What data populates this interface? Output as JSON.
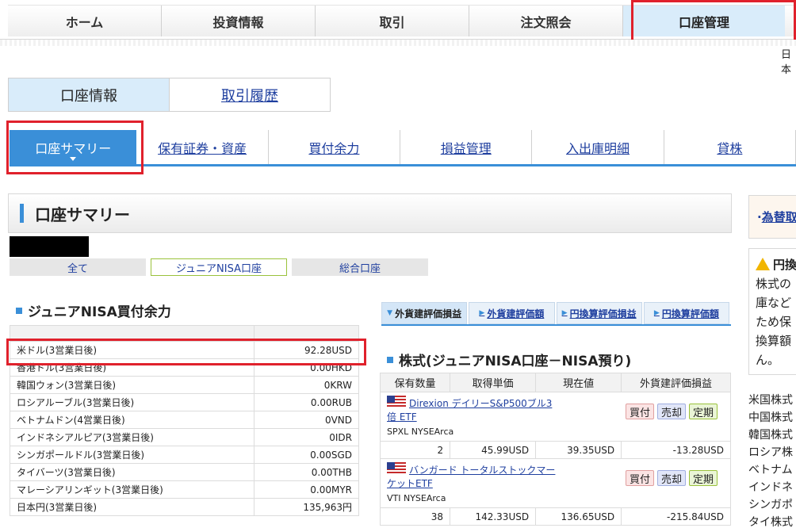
{
  "topnav": [
    "ホーム",
    "投資情報",
    "取引",
    "注文照会",
    "口座管理"
  ],
  "lang": "日本",
  "subtabs": [
    "口座情報",
    "取引履歴"
  ],
  "tabs3": [
    "口座サマリー",
    "保有証券・資産",
    "買付余力",
    "損益管理",
    "入出庫明細",
    "貸株"
  ],
  "page_title": "口座サマリー",
  "acc_tabs": [
    "全て",
    "ジュニアNISA口座",
    "総合口座"
  ],
  "left": {
    "title": "ジュニアNISA買付余力",
    "rows": [
      {
        "label": "米ドル(3営業日後)",
        "value": "92.28USD"
      },
      {
        "label": "香港ドル(3営業日後)",
        "value": "0.00HKD"
      },
      {
        "label": "韓国ウォン(3営業日後)",
        "value": "0KRW"
      },
      {
        "label": "ロシアルーブル(3営業日後)",
        "value": "0.00RUB"
      },
      {
        "label": "ベトナムドン(4営業日後)",
        "value": "0VND"
      },
      {
        "label": "インドネシアルピア(3営業日後)",
        "value": "0IDR"
      },
      {
        "label": "シンガポールドル(3営業日後)",
        "value": "0.00SGD"
      },
      {
        "label": "タイバーツ(3営業日後)",
        "value": "0.00THB"
      },
      {
        "label": "マレーシアリンギット(3営業日後)",
        "value": "0.00MYR"
      },
      {
        "label": "日本円(3営業日後)",
        "value": "135,963円"
      }
    ]
  },
  "valtabs": [
    "外貨建評価損益",
    "外貨建評価額",
    "円換算評価損益",
    "円換算評価額"
  ],
  "stocks": {
    "title": "株式(ジュニアNISA口座－NISA預り)",
    "headers": [
      "保有数量",
      "取得単価",
      "現在値",
      "外貨建評価損益"
    ],
    "buttons": {
      "buy": "買付",
      "sell": "売却",
      "reg": "定期"
    },
    "items": [
      {
        "name_l1": "Direxion デイリーS&P500ブル3",
        "name_l2": "倍 ETF",
        "ticker": "SPXL NYSEArca",
        "qty": "2",
        "cost": "45.99USD",
        "price": "39.35USD",
        "pl": "-13.28USD"
      },
      {
        "name_l1": "バンガード トータルストックマー",
        "name_l2": "ケットETF",
        "ticker": "VTI NYSEArca",
        "qty": "38",
        "cost": "142.33USD",
        "price": "136.65USD",
        "pl": "-215.84USD"
      }
    ]
  },
  "right": {
    "fx_link": "為替取",
    "notice_title": "円換",
    "notice_lines": [
      "株式の",
      "庫など",
      "ため保",
      "換算額",
      "ん。"
    ],
    "list": [
      "米国株式",
      "中国株式",
      "韓国株式",
      "ロシア株",
      "ベトナム",
      "インドネ",
      "シンガポ",
      "タイ株式"
    ]
  },
  "colors": {
    "accent": "#3a8fd8",
    "highlight": "#e0212c",
    "link": "#1f3f9f"
  }
}
